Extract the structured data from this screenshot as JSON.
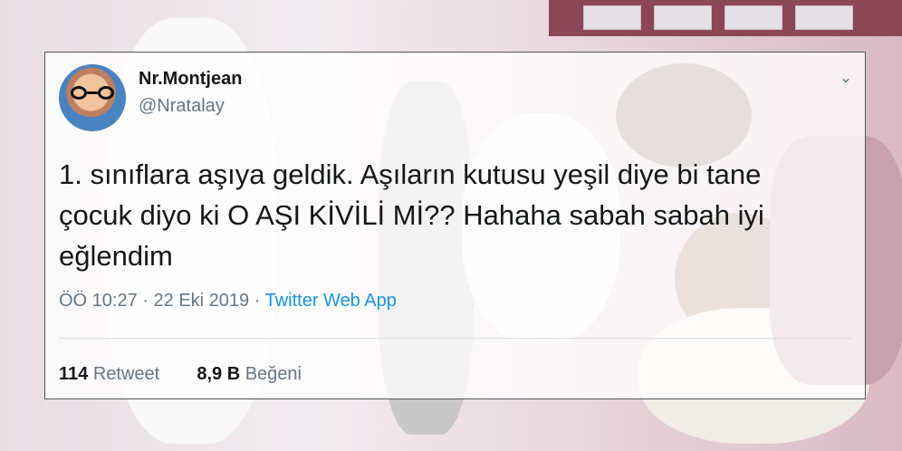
{
  "tweet": {
    "display_name": "Nr.Montjean",
    "handle": "@Nratalay",
    "text": "1. sınıflara aşıya geldik. Aşıların kutusu yeşil diye bi tane\nçocuk diyo ki O AŞI KİVİLİ Mİ?? Hahaha sabah sabah iyi\neğlendim",
    "time": "ÖÖ 10:27",
    "separator": "·",
    "date": "22 Eki 2019",
    "source": "Twitter Web App",
    "retweets": {
      "value": "114",
      "label": "Retweet"
    },
    "likes": {
      "value": "8,9 B",
      "label": "Beğeni"
    }
  },
  "icons": {
    "menu": "chevron-down-icon",
    "avatar": "avatar"
  },
  "colors": {
    "primary_text": "#14171a",
    "secondary_text": "#657786",
    "link": "#1b95e0"
  }
}
